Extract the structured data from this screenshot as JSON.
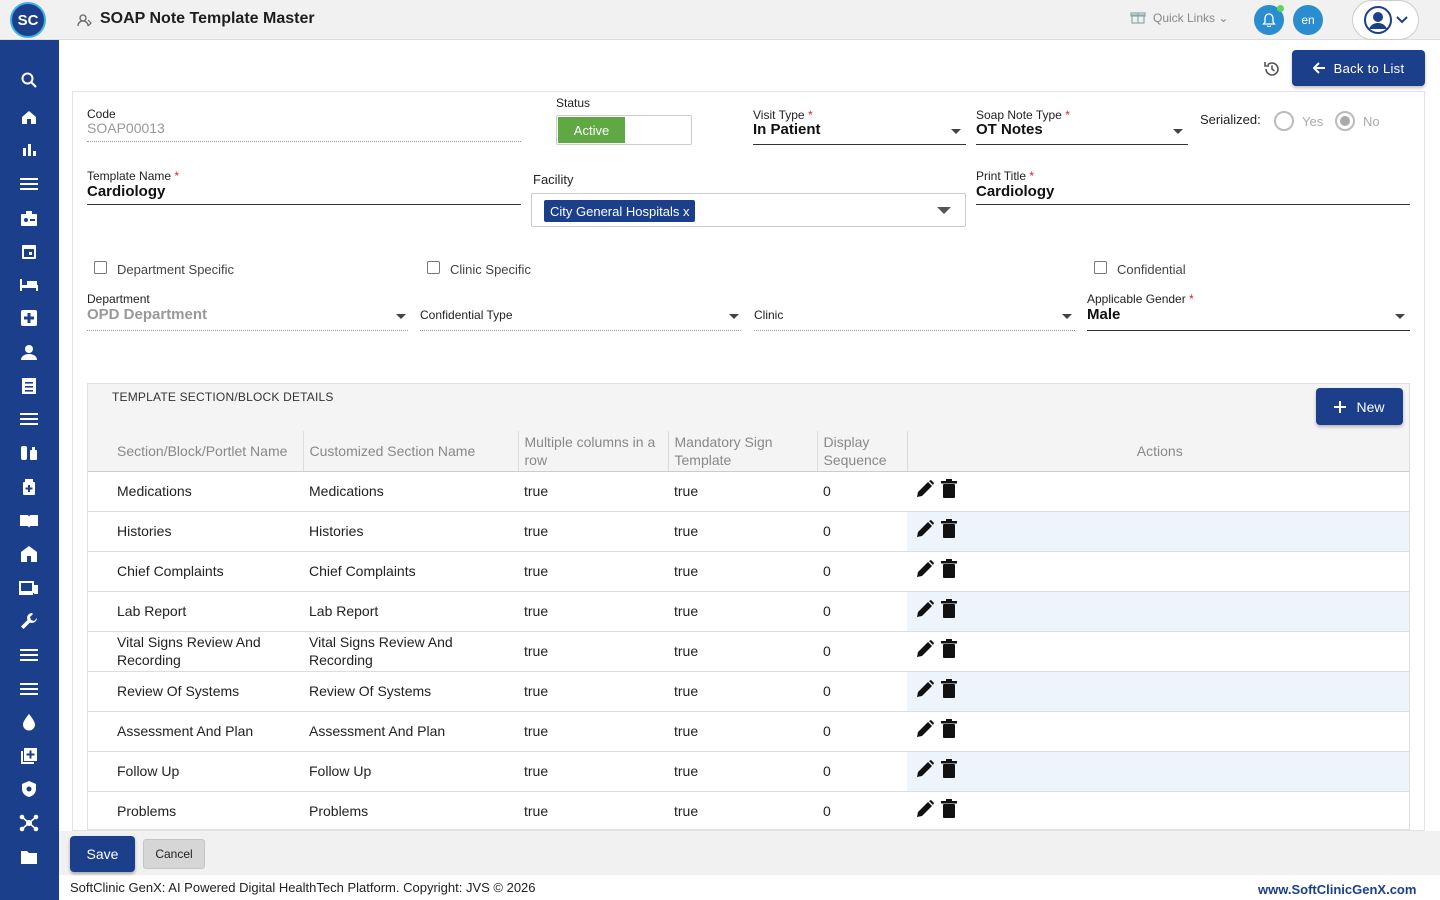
{
  "header": {
    "logo_text": "SC",
    "title": "SOAP Note Template Master",
    "quick_links": "Quick Links",
    "language": "en"
  },
  "sidebar": {
    "icons": [
      "search-icon",
      "home-icon",
      "bar-chart-icon",
      "menu-icon",
      "badge-icon",
      "calendar-icon",
      "bed-icon",
      "medical-cross-icon",
      "person-icon",
      "document-list-icon",
      "menu-icon",
      "pharmacy-icon",
      "medicine-box-icon",
      "book-icon",
      "building-icon",
      "devices-icon",
      "wrench-icon",
      "menu-icon",
      "menu-icon",
      "drop-icon",
      "add-box-icon",
      "shield-icon",
      "network-icon",
      "folder-icon"
    ]
  },
  "toolbar": {
    "back_label": "Back to List"
  },
  "form": {
    "code": {
      "label": "Code",
      "value": "SOAP00013"
    },
    "status": {
      "label": "Status",
      "value": "Active"
    },
    "visit_type": {
      "label": "Visit Type",
      "required": "*",
      "value": "In Patient"
    },
    "soap_note_type": {
      "label": "Soap Note Type",
      "required": "*",
      "value": "OT Notes"
    },
    "serialized": {
      "label": "Serialized:",
      "yes": "Yes",
      "no": "No",
      "selected": "No"
    },
    "template_name": {
      "label": "Template Name",
      "required": "*",
      "value": "Cardiology"
    },
    "facility": {
      "label": "Facility",
      "chip": "City General Hospitals",
      "chip_remove": "x"
    },
    "print_title": {
      "label": "Print Title",
      "required": "*",
      "value": "Cardiology"
    },
    "department_specific": "Department Specific",
    "clinic_specific": "Clinic Specific",
    "confidential": "Confidential",
    "department": {
      "label": "Department",
      "value": "OPD Department"
    },
    "confidential_type": {
      "label": "Confidential Type"
    },
    "clinic": {
      "label": "Clinic"
    },
    "applicable_gender": {
      "label": "Applicable Gender",
      "required": "*",
      "value": "Male"
    }
  },
  "section": {
    "title": "TEMPLATE SECTION/BLOCK DETAILS",
    "new_label": "New",
    "columns": [
      "Section/Block/Portlet Name",
      "Customized Section Name",
      "Multiple columns in a row",
      "Mandatory Sign Template",
      "Display Sequence",
      "Actions"
    ],
    "rows": [
      [
        "Medications",
        "Medications",
        "true",
        "true",
        "0"
      ],
      [
        "Histories",
        "Histories",
        "true",
        "true",
        "0"
      ],
      [
        "Chief Complaints",
        "Chief Complaints",
        "true",
        "true",
        "0"
      ],
      [
        "Lab Report",
        "Lab Report",
        "true",
        "true",
        "0"
      ],
      [
        "Vital Signs Review And Recording",
        "Vital Signs Review And Recording",
        "true",
        "true",
        "0"
      ],
      [
        "Review Of Systems",
        "Review Of Systems",
        "true",
        "true",
        "0"
      ],
      [
        "Assessment And Plan",
        "Assessment And Plan",
        "true",
        "true",
        "0"
      ],
      [
        "Follow Up",
        "Follow Up",
        "true",
        "true",
        "0"
      ],
      [
        "Problems",
        "Problems",
        "true",
        "true",
        "0"
      ]
    ]
  },
  "footer": {
    "save_label": "Save",
    "cancel_label": "Cancel",
    "copyright": "SoftClinic GenX: AI Powered Digital HealthTech Platform. Copyright: JVS © 2026",
    "site": "www.SoftClinicGenX.com"
  },
  "colors": {
    "brand": "#1c3f8c",
    "status_on": "#5fa843",
    "accent": "#2a8dd0"
  }
}
